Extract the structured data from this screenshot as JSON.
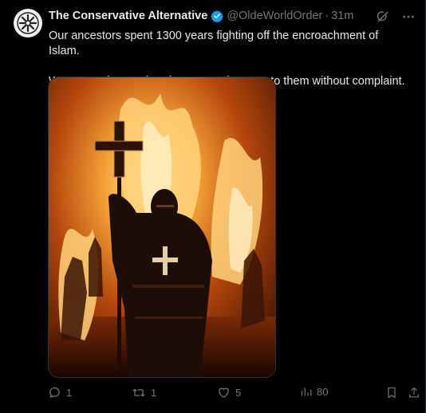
{
  "tweet": {
    "author_name": "The Conservative Alternative",
    "handle": "@OldeWorldOrder",
    "separator": "·",
    "time": "31m",
    "text_line1": "Our ancestors spent 1300 years fighting off the encroachment of Islam.",
    "text_line2": "We're not about to hand our countries over to them without complaint."
  },
  "actions": {
    "replies": "1",
    "reposts": "1",
    "likes": "5",
    "views": "80"
  },
  "icons": {
    "avatar": "cross-emblem-icon",
    "verified": "verified-badge-icon",
    "grok": "grok-icon",
    "more": "more-icon",
    "reply": "reply-icon",
    "repost": "repost-icon",
    "like": "heart-icon",
    "views": "views-icon",
    "bookmark": "bookmark-icon",
    "share": "share-icon"
  },
  "colors": {
    "verified": "#1d9bf0",
    "muted": "#71767b",
    "text": "#e7e9ea"
  }
}
